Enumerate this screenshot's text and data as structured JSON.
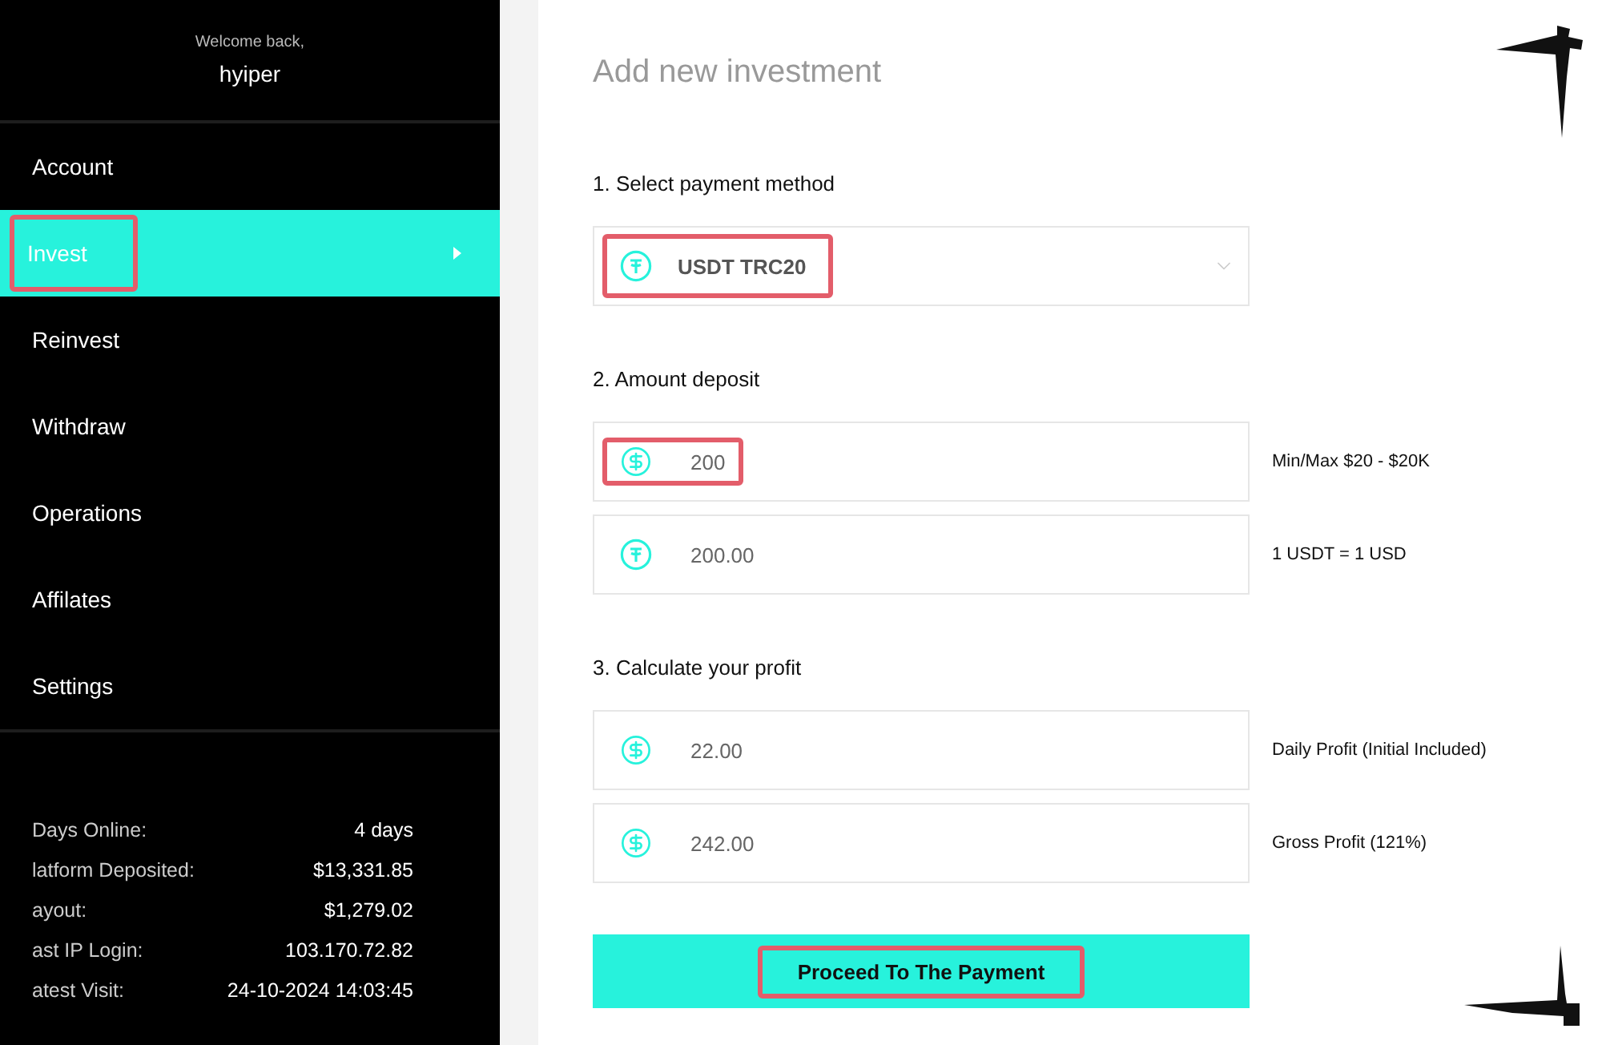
{
  "sidebar": {
    "welcome": "Welcome back,",
    "username": "hyiper",
    "items": [
      {
        "label": "Account",
        "selected": false,
        "highlighted": false
      },
      {
        "label": "Invest",
        "selected": true,
        "highlighted": true
      },
      {
        "label": "Reinvest",
        "selected": false,
        "highlighted": false
      },
      {
        "label": "Withdraw",
        "selected": false,
        "highlighted": false
      },
      {
        "label": "Operations",
        "selected": false,
        "highlighted": false
      },
      {
        "label": "Affilates",
        "selected": false,
        "highlighted": false
      },
      {
        "label": "Settings",
        "selected": false,
        "highlighted": false
      }
    ],
    "stats": [
      {
        "label": "Days Online:",
        "value": "4 days"
      },
      {
        "label": "latform Deposited:",
        "value": "$13,331.85"
      },
      {
        "label": "ayout:",
        "value": "$1,279.02"
      },
      {
        "label": "ast IP Login:",
        "value": "103.170.72.82"
      },
      {
        "label": "atest Visit:",
        "value": "24-10-2024 14:03:45"
      }
    ]
  },
  "main": {
    "title": "Add new investment",
    "sections": [
      {
        "heading": "1. Select payment method",
        "fields": [
          {
            "kind": "usdt-select",
            "value": "USDT TRC20",
            "highlighted": true
          }
        ]
      },
      {
        "heading": "2. Amount deposit",
        "fields": [
          {
            "kind": "usd-input",
            "value": "200",
            "note": "Min/Max $20 - $20K",
            "highlighted": true
          },
          {
            "kind": "usdt-input",
            "value": "200.00",
            "note": "1 USDT = 1 USD",
            "highlighted": false
          }
        ]
      },
      {
        "heading": "3. Calculate your profit",
        "fields": [
          {
            "kind": "usd-input",
            "value": "22.00",
            "note": "Daily Profit (Initial Included)",
            "highlighted": false
          },
          {
            "kind": "usd-input",
            "value": "242.00",
            "note": "Gross Profit (121%)",
            "highlighted": false
          }
        ]
      }
    ],
    "submit": {
      "label": "Proceed To The Payment",
      "highlighted": true
    }
  }
}
